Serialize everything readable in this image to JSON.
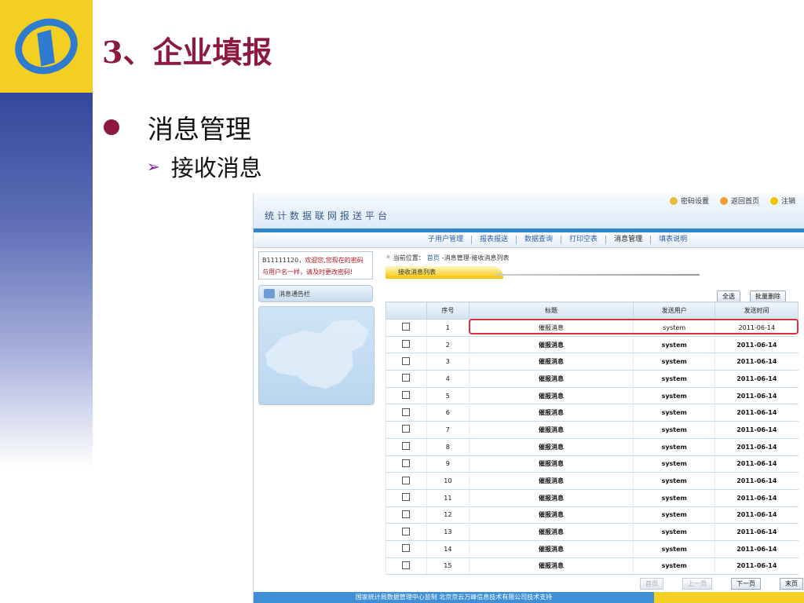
{
  "slide": {
    "title": "3、企业填报",
    "bullet1": "消息管理",
    "bullet2": "接收消息"
  },
  "app": {
    "title": "统计数据联网报送平台",
    "toplinks": [
      "密码设置",
      "返回首页",
      "注销"
    ],
    "nav": [
      "子用户管理",
      "报表报送",
      "数据查询",
      "打印空表",
      "消息管理",
      "填表说明"
    ],
    "welcome_uid": "B11111120，",
    "welcome_text1": "欢迎您,您现在的密码",
    "welcome_text2": "与用户名一样，请及时更改密码!",
    "notice_label": "消息通告栏",
    "crumb_prefix": "当前位置：",
    "crumb_home": "首页",
    "crumb_rest": "-消息管理-接收消息列表",
    "tab_label": "接收消息列表",
    "select_all": "全选",
    "batch_delete": "批量删除",
    "columns": [
      "序号",
      "标题",
      "发送用户",
      "发送时间"
    ],
    "rows": [
      {
        "no": "1",
        "title": "催报消息",
        "user": "system",
        "time": "2011-06-14",
        "bold": false
      },
      {
        "no": "2",
        "title": "催报消息",
        "user": "system",
        "time": "2011-06-14",
        "bold": true
      },
      {
        "no": "3",
        "title": "催报消息",
        "user": "system",
        "time": "2011-06-14",
        "bold": true
      },
      {
        "no": "4",
        "title": "催报消息",
        "user": "system",
        "time": "2011-06-14",
        "bold": true
      },
      {
        "no": "5",
        "title": "催报消息",
        "user": "system",
        "time": "2011-06-14",
        "bold": true
      },
      {
        "no": "6",
        "title": "催报消息",
        "user": "system",
        "time": "2011-06-14",
        "bold": true
      },
      {
        "no": "7",
        "title": "催报消息",
        "user": "system",
        "time": "2011-06-14",
        "bold": true
      },
      {
        "no": "8",
        "title": "催报消息",
        "user": "system",
        "time": "2011-06-14",
        "bold": true
      },
      {
        "no": "9",
        "title": "催报消息",
        "user": "system",
        "time": "2011-06-14",
        "bold": true
      },
      {
        "no": "10",
        "title": "催报消息",
        "user": "system",
        "time": "2011-06-14",
        "bold": true
      },
      {
        "no": "11",
        "title": "催报消息",
        "user": "system",
        "time": "2011-06-14",
        "bold": true
      },
      {
        "no": "12",
        "title": "催报消息",
        "user": "system",
        "time": "2011-06-14",
        "bold": true
      },
      {
        "no": "13",
        "title": "催报消息",
        "user": "system",
        "time": "2011-06-14",
        "bold": true
      },
      {
        "no": "14",
        "title": "催报消息",
        "user": "system",
        "time": "2011-06-14",
        "bold": true
      },
      {
        "no": "15",
        "title": "催报消息",
        "user": "system",
        "time": "2011-06-14",
        "bold": true
      }
    ],
    "pager": [
      {
        "label": "首页",
        "disabled": true
      },
      {
        "label": "上一页",
        "disabled": true
      },
      {
        "label": "下一页",
        "disabled": false
      },
      {
        "label": "末页",
        "disabled": false
      }
    ],
    "footer": "国家统计局数据管理中心监制 北京京云万峰信息技术有限公司技术支持"
  },
  "colors": {
    "accent": "#8b1a3e",
    "logo_yellow": "#f3cf23",
    "band_blue": "#33479a",
    "highlight": "#d9333a"
  }
}
